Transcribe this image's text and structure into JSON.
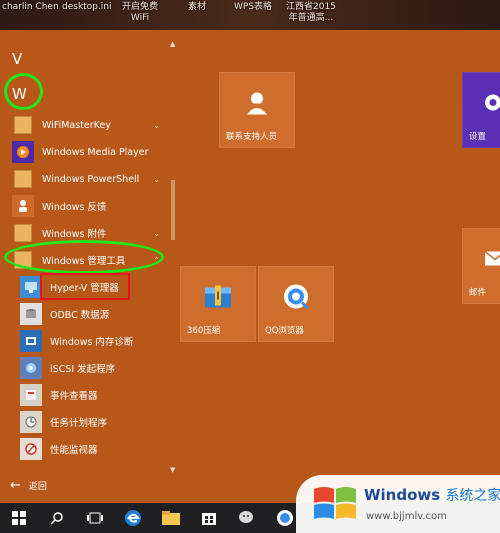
{
  "desktop": {
    "labels": [
      "charlin Chen",
      "desktop.ini",
      "开启免费\nWiFi",
      "素材",
      "WPS表格",
      "江西省2015\n年普通高..."
    ]
  },
  "start_menu": {
    "headers": {
      "v": "V",
      "w": "W"
    },
    "apps": [
      {
        "label": "WiFiMasterKey",
        "has_chevron": true
      },
      {
        "label": "Windows Media Player",
        "has_chevron": false
      },
      {
        "label": "Windows PowerShell",
        "has_chevron": true
      },
      {
        "label": "Windows 反馈",
        "has_chevron": false
      },
      {
        "label": "Windows 附件",
        "has_chevron": true
      },
      {
        "label": "Windows 管理工具",
        "has_chevron": true,
        "expanded": true
      },
      {
        "label": "Hyper-V 管理器",
        "sub": true
      },
      {
        "label": "ODBC 数据源",
        "sub": true
      },
      {
        "label": "Windows 内存诊断",
        "sub": true
      },
      {
        "label": "iSCSI 发起程序",
        "sub": true
      },
      {
        "label": "事件查看器",
        "sub": true
      },
      {
        "label": "任务计划程序",
        "sub": true
      },
      {
        "label": "性能监视器",
        "sub": true
      }
    ],
    "back_label": "返回",
    "tiles": [
      {
        "name": "support",
        "label": "联系支持人员"
      },
      {
        "name": "settings",
        "label": "设置"
      },
      {
        "name": "360zip",
        "label": "360压缩"
      },
      {
        "name": "qqbrowser",
        "label": "QQ浏览器"
      },
      {
        "name": "mail",
        "label": "邮件"
      }
    ]
  },
  "taskbar": {
    "icons": [
      "windows-start-icon",
      "search-icon",
      "task-view-icon",
      "edge-icon",
      "file-explorer-icon",
      "store-icon",
      "wechat-icon",
      "qq-browser-icon"
    ]
  },
  "watermark": {
    "brand": "Windows",
    "suffix": "系统之家",
    "url": "www.bjjmlv.com"
  },
  "colors": {
    "accent": "#b85819",
    "tile": "#cf6d2d",
    "annotation_green": "#22e51b",
    "annotation_red": "#e4141a",
    "taskbar": "#201f22"
  }
}
